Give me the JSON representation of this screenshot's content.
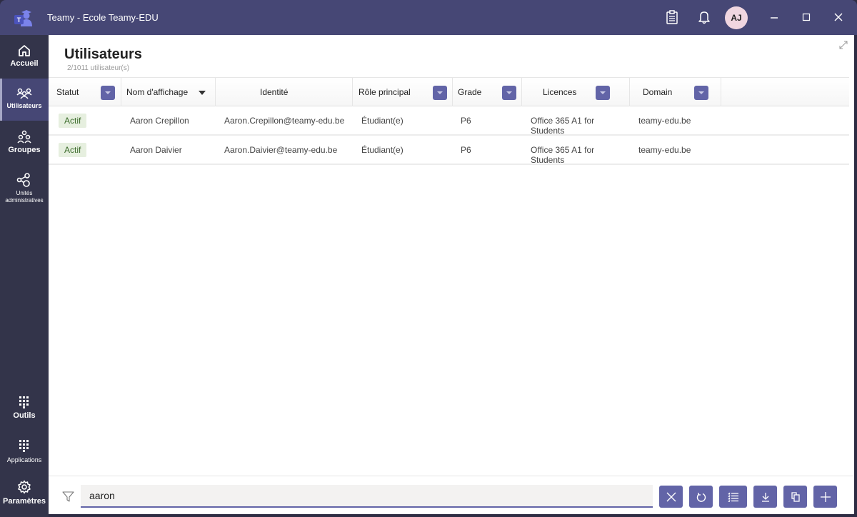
{
  "window": {
    "title": "Teamy - Ecole Teamy-EDU",
    "avatar_initials": "AJ",
    "icons": [
      "clipboard-icon",
      "bell-icon",
      "minimize-icon",
      "maximize-icon",
      "close-icon"
    ]
  },
  "sidebar": {
    "items": [
      {
        "label": "Accueil",
        "icon": "home-icon"
      },
      {
        "label": "Utilisateurs",
        "icon": "users-icon",
        "active": true
      },
      {
        "label": "Groupes",
        "icon": "groups-icon"
      },
      {
        "label": "Unités administratives",
        "icon": "admin-units-icon"
      },
      {
        "label": "Outils",
        "icon": "grid-icon"
      },
      {
        "label": "Applications",
        "icon": "grid-icon"
      },
      {
        "label": "Paramètres",
        "icon": "gear-icon"
      }
    ]
  },
  "page": {
    "title": "Utilisateurs",
    "count": "2/1011 utilisateur(s)"
  },
  "table": {
    "columns": [
      {
        "label": "Statut",
        "filter": true
      },
      {
        "label": "Nom d'affichage",
        "sort": "desc"
      },
      {
        "label": "Identité"
      },
      {
        "label": "Rôle principal",
        "filter": true
      },
      {
        "label": "Grade",
        "filter": true
      },
      {
        "label": "Licences",
        "filter": true
      },
      {
        "label": "Domain",
        "filter": true
      }
    ],
    "rows": [
      {
        "statut": "Actif",
        "nom": "Aaron Crepillon",
        "identite": "Aaron.Crepillon@teamy-edu.be",
        "role": "Étudiant(e)",
        "grade": "P6",
        "licences": "Office 365 A1 for Students",
        "domain": "teamy-edu.be"
      },
      {
        "statut": "Actif",
        "nom": "Aaron Daivier",
        "identite": "Aaron.Daivier@teamy-edu.be",
        "role": "Étudiant(e)",
        "grade": "P6",
        "licences": "Office 365 A1 for Students",
        "domain": "teamy-edu.be"
      }
    ]
  },
  "footer": {
    "search_value": "aaron",
    "actions": [
      "clear-icon",
      "refresh-icon",
      "checklist-icon",
      "download-icon",
      "copy-icon",
      "add-icon"
    ]
  },
  "colors": {
    "accent": "#6264a7",
    "titlebar": "#464775",
    "sidebar": "#33344a",
    "badge_bg": "#e6efdf"
  }
}
